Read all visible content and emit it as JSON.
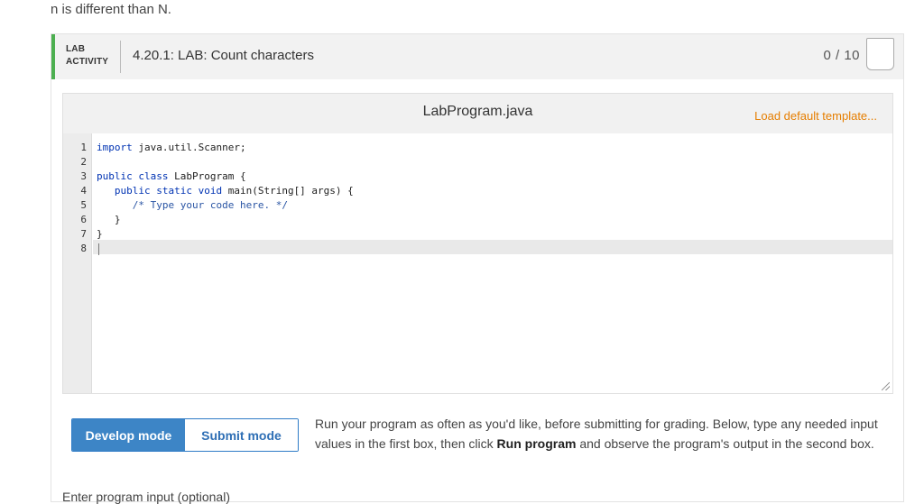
{
  "intro": "n is different than N.",
  "activity": {
    "tag_line1": "LAB",
    "tag_line2": "ACTIVITY",
    "title": "4.20.1: LAB: Count characters",
    "score": "0 / 10"
  },
  "editor": {
    "file_name": "LabProgram.java",
    "load_template": "Load default template...",
    "line_numbers": [
      "1",
      "2",
      "3",
      "4",
      "5",
      "6",
      "7",
      "8"
    ]
  },
  "modes": {
    "develop": "Develop mode",
    "submit": "Submit mode"
  },
  "instructions": {
    "part1": "Run your program as often as you'd like, before submitting for grading. Below, type any needed input values in the first box, then click ",
    "run_label": "Run program",
    "part2": " and observe the program's output in the second box."
  },
  "next_section_label": "Enter program input (optional)"
}
